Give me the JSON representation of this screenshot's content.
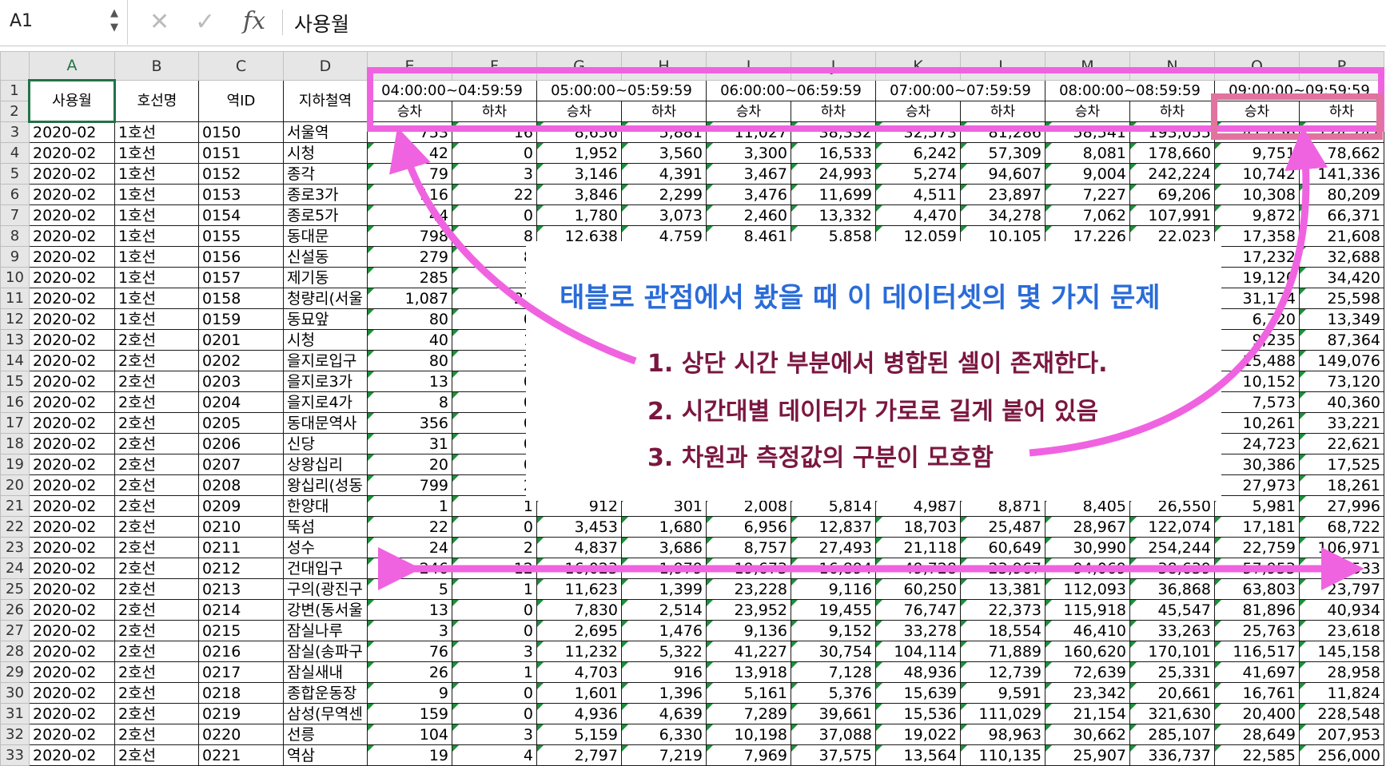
{
  "formula_bar": {
    "cell_ref": "A1",
    "fx_label": "fx",
    "cancel_glyph": "✕",
    "enter_glyph": "✓",
    "value": "사용월"
  },
  "columns": [
    "A",
    "B",
    "C",
    "D",
    "E",
    "F",
    "G",
    "H",
    "I",
    "J",
    "K",
    "L",
    "M",
    "N",
    "O",
    "P"
  ],
  "header": {
    "month": "사용월",
    "line": "호선명",
    "station_id": "역ID",
    "station": "지하철역",
    "time_slots": [
      "04:00:00~04:59:59",
      "05:00:00~05:59:59",
      "06:00:00~06:59:59",
      "07:00:00~07:59:59",
      "08:00:00~08:59:59",
      "09:00:00~09:59:59"
    ],
    "board": "승차",
    "alight": "하차"
  },
  "row_numbers": [
    "1",
    "2",
    "3",
    "4",
    "5",
    "6",
    "7",
    "8",
    "9",
    "10",
    "11",
    "12",
    "13",
    "14",
    "15",
    "16",
    "17",
    "18",
    "19",
    "20",
    "21",
    "22",
    "23",
    "24",
    "25",
    "26",
    "27",
    "28",
    "29",
    "30",
    "31",
    "32",
    "33"
  ],
  "rows": [
    [
      "2020-02",
      "1호선",
      "0150",
      "서울역",
      "753",
      "16",
      "8,656",
      "5,881",
      "11,027",
      "38,332",
      "32,573",
      "81,286",
      "58,541",
      "193,055",
      "41,456",
      "124,747"
    ],
    [
      "2020-02",
      "1호선",
      "0151",
      "시청",
      "42",
      "0",
      "1,952",
      "3,560",
      "3,300",
      "16,533",
      "6,242",
      "57,309",
      "8,081",
      "178,660",
      "9,751",
      "78,662"
    ],
    [
      "2020-02",
      "1호선",
      "0152",
      "종각",
      "79",
      "3",
      "3,146",
      "4,391",
      "3,467",
      "24,993",
      "5,274",
      "94,607",
      "9,004",
      "242,224",
      "10,742",
      "141,336"
    ],
    [
      "2020-02",
      "1호선",
      "0153",
      "종로3가",
      "116",
      "22",
      "3,846",
      "2,299",
      "3,476",
      "11,699",
      "4,511",
      "23,897",
      "7,227",
      "69,206",
      "10,308",
      "80,209"
    ],
    [
      "2020-02",
      "1호선",
      "0154",
      "종로5가",
      "44",
      "0",
      "1,780",
      "3,073",
      "2,460",
      "13,332",
      "4,470",
      "34,278",
      "7,062",
      "107,991",
      "9,872",
      "66,371"
    ],
    [
      "2020-02",
      "1호선",
      "0155",
      "동대문",
      "798",
      "8",
      "12,638",
      "4,759",
      "8,461",
      "5,858",
      "12,059",
      "10,105",
      "17,226",
      "22,023",
      "17,358",
      "21,608"
    ],
    [
      "2020-02",
      "1호선",
      "0156",
      "신설동",
      "279",
      "8",
      "",
      "",
      "",
      "",
      "",
      "",
      "",
      "",
      "17,232",
      "32,688"
    ],
    [
      "2020-02",
      "1호선",
      "0157",
      "제기동",
      "285",
      "1",
      "",
      "",
      "",
      "",
      "",
      "",
      "",
      "",
      "19,120",
      "34,420"
    ],
    [
      "2020-02",
      "1호선",
      "0158",
      "청량리(서울",
      "1,087",
      "23",
      "",
      "",
      "",
      "",
      "",
      "",
      "",
      "",
      "31,174",
      "25,598"
    ],
    [
      "2020-02",
      "1호선",
      "0159",
      "동묘앞",
      "80",
      "0",
      "",
      "",
      "",
      "",
      "",
      "",
      "",
      "",
      "6,720",
      "13,349"
    ],
    [
      "2020-02",
      "2호선",
      "0201",
      "시청",
      "40",
      "1",
      "",
      "",
      "",
      "",
      "",
      "",
      "",
      "",
      "9,235",
      "87,364"
    ],
    [
      "2020-02",
      "2호선",
      "0202",
      "을지로입구",
      "80",
      "2",
      "",
      "",
      "",
      "",
      "",
      "",
      "",
      "",
      "15,488",
      "149,076"
    ],
    [
      "2020-02",
      "2호선",
      "0203",
      "을지로3가",
      "13",
      "0",
      "",
      "",
      "",
      "",
      "",
      "",
      "",
      "",
      "10,152",
      "73,120"
    ],
    [
      "2020-02",
      "2호선",
      "0204",
      "을지로4가",
      "8",
      "0",
      "",
      "",
      "",
      "",
      "",
      "",
      "",
      "",
      "7,573",
      "40,360"
    ],
    [
      "2020-02",
      "2호선",
      "0205",
      "동대문역사",
      "356",
      "0",
      "",
      "",
      "",
      "",
      "",
      "",
      "",
      "",
      "10,261",
      "33,221"
    ],
    [
      "2020-02",
      "2호선",
      "0206",
      "신당",
      "31",
      "0",
      "",
      "",
      "",
      "",
      "",
      "",
      "",
      "",
      "24,723",
      "22,621"
    ],
    [
      "2020-02",
      "2호선",
      "0207",
      "상왕십리",
      "20",
      "0",
      "",
      "",
      "",
      "",
      "",
      "",
      "",
      "",
      "30,386",
      "17,525"
    ],
    [
      "2020-02",
      "2호선",
      "0208",
      "왕십리(성동",
      "799",
      "2",
      "",
      "",
      "",
      "",
      "",
      "",
      "",
      "",
      "27,973",
      "18,261"
    ],
    [
      "2020-02",
      "2호선",
      "0209",
      "한양대",
      "1",
      "1",
      "912",
      "301",
      "2,008",
      "5,814",
      "4,987",
      "8,871",
      "8,405",
      "26,550",
      "5,981",
      "27,996"
    ],
    [
      "2020-02",
      "2호선",
      "0210",
      "뚝섬",
      "22",
      "0",
      "3,453",
      "1,680",
      "6,956",
      "12,837",
      "18,703",
      "25,487",
      "28,967",
      "122,074",
      "17,181",
      "68,722"
    ],
    [
      "2020-02",
      "2호선",
      "0211",
      "성수",
      "24",
      "2",
      "4,837",
      "3,686",
      "8,757",
      "27,493",
      "21,118",
      "60,649",
      "30,990",
      "254,244",
      "22,759",
      "106,971"
    ],
    [
      "2020-02",
      "2호선",
      "0212",
      "건대입구",
      "246",
      "12",
      "16,023",
      "1,979",
      "19,673",
      "16,894",
      "49,728",
      "23,967",
      "94,069",
      "38,639",
      "57,953",
      "41,533"
    ],
    [
      "2020-02",
      "2호선",
      "0213",
      "구의(광진구",
      "5",
      "1",
      "11,623",
      "1,399",
      "23,228",
      "9,116",
      "60,250",
      "13,381",
      "112,093",
      "36,868",
      "63,803",
      "23,797"
    ],
    [
      "2020-02",
      "2호선",
      "0214",
      "강변(동서울",
      "13",
      "0",
      "7,830",
      "2,514",
      "23,952",
      "19,455",
      "76,747",
      "22,373",
      "115,918",
      "45,547",
      "81,896",
      "40,934"
    ],
    [
      "2020-02",
      "2호선",
      "0215",
      "잠실나루",
      "3",
      "0",
      "2,695",
      "1,476",
      "9,136",
      "9,152",
      "33,278",
      "18,554",
      "46,410",
      "33,263",
      "25,763",
      "23,618"
    ],
    [
      "2020-02",
      "2호선",
      "0216",
      "잠실(송파구",
      "76",
      "3",
      "11,232",
      "5,322",
      "41,227",
      "30,754",
      "104,114",
      "71,889",
      "160,620",
      "170,101",
      "116,517",
      "145,158"
    ],
    [
      "2020-02",
      "2호선",
      "0217",
      "잠실새내",
      "26",
      "1",
      "4,703",
      "916",
      "13,918",
      "7,128",
      "48,936",
      "12,739",
      "72,639",
      "25,331",
      "41,697",
      "28,958"
    ],
    [
      "2020-02",
      "2호선",
      "0218",
      "종합운동장",
      "9",
      "0",
      "1,601",
      "1,396",
      "5,161",
      "5,376",
      "15,639",
      "9,591",
      "23,342",
      "20,661",
      "16,761",
      "11,824"
    ],
    [
      "2020-02",
      "2호선",
      "0219",
      "삼성(무역센",
      "159",
      "0",
      "4,936",
      "4,639",
      "7,289",
      "39,661",
      "15,536",
      "111,029",
      "21,154",
      "321,630",
      "20,400",
      "228,548"
    ],
    [
      "2020-02",
      "2호선",
      "0220",
      "선릉",
      "104",
      "3",
      "5,159",
      "6,330",
      "10,198",
      "37,088",
      "19,022",
      "98,963",
      "30,662",
      "285,107",
      "28,649",
      "207,953"
    ],
    [
      "2020-02",
      "2호선",
      "0221",
      "역삼",
      "19",
      "4",
      "2,797",
      "7,219",
      "7,969",
      "37,575",
      "13,564",
      "110,135",
      "25,907",
      "336,737",
      "22,585",
      "256,000"
    ]
  ],
  "annotation": {
    "title": "태블로 관점에서 봤을 때 이 데이터셋의 몇 가지 문제",
    "items": [
      "1. 상단 시간 부분에서 병합된 셀이 존재한다.",
      "2. 시간대별 데이터가 가로로 길게 붙어 있음",
      "3. 차원과 측정값의 구분이 모호함"
    ]
  },
  "colors": {
    "highlight": "#f063e0",
    "highlight_box": "#e2729e",
    "title": "#2a6bd8",
    "item": "#7a1740",
    "selection": "#217346",
    "number_marker": "#1d8f3a"
  }
}
